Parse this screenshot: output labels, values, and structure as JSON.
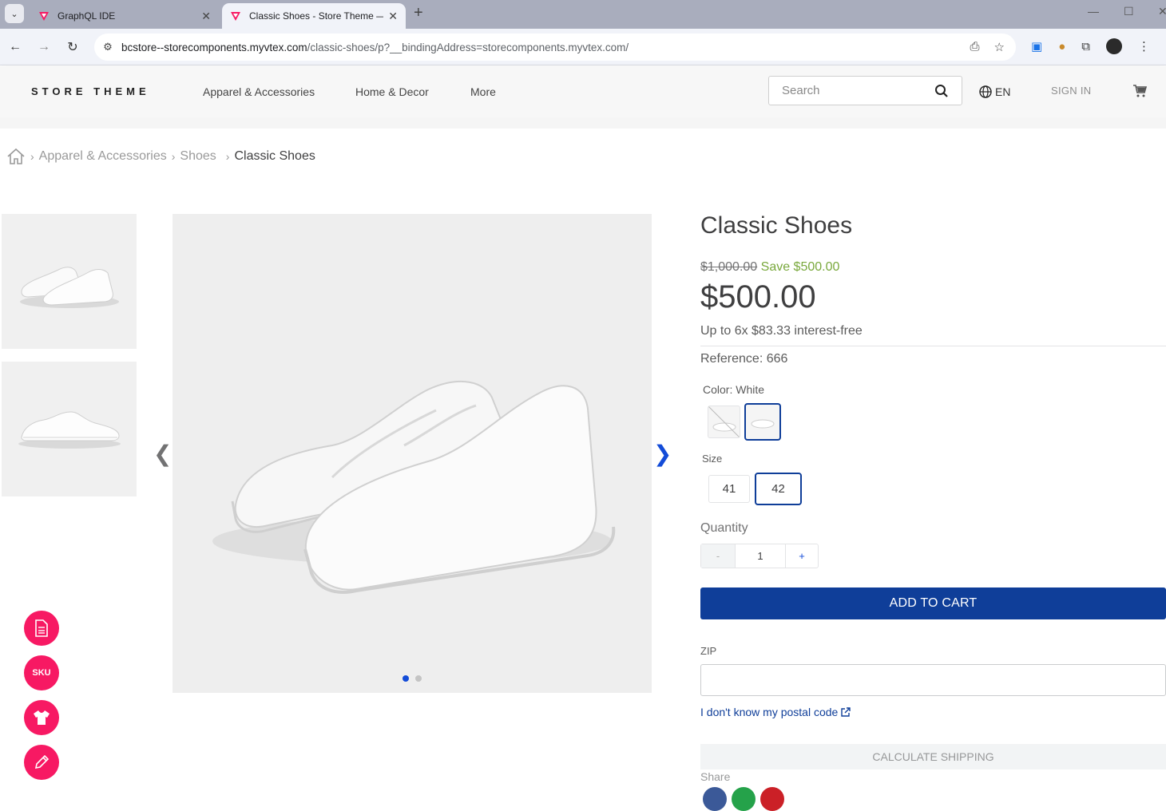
{
  "browser": {
    "tabs": [
      {
        "title": "GraphQL IDE",
        "active": false
      },
      {
        "title": "Classic Shoes - Store Theme —",
        "active": true
      }
    ],
    "url_host": "bcstore--storecomponents.myvtex.com",
    "url_path": "/classic-shoes/p?__bindingAddress=storecomponents.myvtex.com/"
  },
  "header": {
    "logo": "STORE THEME",
    "menu": [
      "Apparel & Accessories",
      "Home & Decor",
      "More"
    ],
    "search_placeholder": "Search",
    "language": "EN",
    "sign_in": "SIGN IN"
  },
  "breadcrumb": {
    "items": [
      "Apparel & Accessories",
      "Shoes"
    ],
    "current": "Classic Shoes"
  },
  "product": {
    "name": "Classic Shoes",
    "list_price": "$1,000.00",
    "savings": "Save $500.00",
    "selling_price": "$500.00",
    "installments": "Up to 6x $83.33 interest-free",
    "reference": "Reference: 666",
    "color_label": "Color: White",
    "size_label": "Size",
    "sizes": [
      "41",
      "42"
    ],
    "selected_size": "42",
    "quantity_label": "Quantity",
    "quantity_minus": "-",
    "quantity_value": "1",
    "quantity_plus": "+",
    "add_to_cart": "ADD TO CART",
    "zip_label": "ZIP",
    "postal_link": "I don't know my postal code",
    "calculate_shipping": "CALCULATE SHIPPING",
    "share_label": "Share"
  },
  "admin_buttons": {
    "sku_label": "SKU"
  },
  "colors": {
    "accent_blue": "#0f3e99",
    "admin_pink": "#f71963",
    "savings_green": "#79a83c"
  }
}
